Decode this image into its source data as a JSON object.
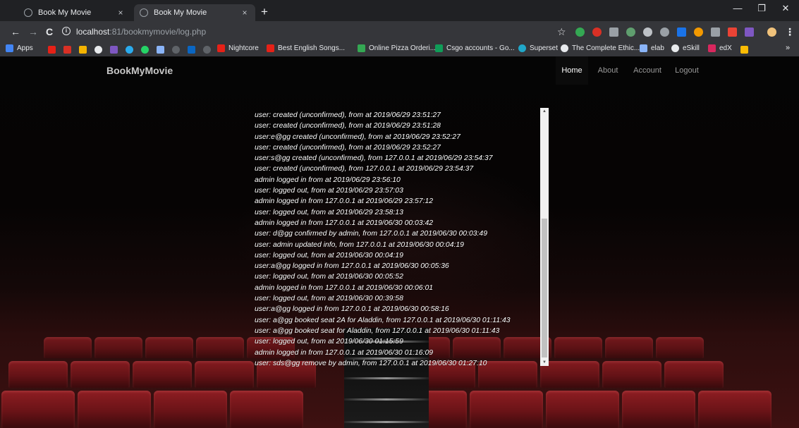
{
  "browser": {
    "tabs": [
      {
        "title": "Book My Movie",
        "active": false
      },
      {
        "title": "Book My Movie",
        "active": true
      }
    ],
    "close_glyph": "×",
    "new_tab_glyph": "+",
    "window_controls": {
      "minimize": "—",
      "maximize": "❐",
      "close": "✕"
    },
    "nav": {
      "back": "←",
      "forward": "→",
      "reload": "C"
    },
    "url": {
      "host": "localhost",
      "rest": ":81/bookmymovie/log.php"
    },
    "star_glyph": "☆",
    "menu_glyph": "⋮",
    "bookmarks": [
      {
        "label": "Apps",
        "color": "#4285f4"
      },
      {
        "label": "Nightcore",
        "color": "#e62117"
      },
      {
        "label": "Best English Songs...",
        "color": "#e62117"
      },
      {
        "label": "Online Pizza Orderi...",
        "color": "#34a853"
      },
      {
        "label": "Csgo accounts - Go...",
        "color": "#0f9d58"
      },
      {
        "label": "Superset",
        "color": "#20a7c9"
      },
      {
        "label": "The Complete Ethic...",
        "color": "#e8eaed"
      },
      {
        "label": "elab",
        "color": "#8ab4f8"
      },
      {
        "label": "eSkill",
        "color": "#e8eaed"
      },
      {
        "label": "edX",
        "color": "#d9275e"
      }
    ],
    "bookmarks_overflow": "»"
  },
  "page": {
    "brand": "BookMyMovie",
    "nav": [
      {
        "label": "Home",
        "active": true
      },
      {
        "label": "About",
        "active": false
      },
      {
        "label": "Account",
        "active": false
      },
      {
        "label": "Logout",
        "active": false
      }
    ],
    "log": [
      "user: created (unconfirmed), from at 2019/06/29 23:51:27",
      "user: created (unconfirmed), from at 2019/06/29 23:51:28",
      "user:e@gg created (unconfirmed), from at 2019/06/29 23:52:27",
      "user: created (unconfirmed), from at 2019/06/29 23:52:27",
      "user:s@gg created (unconfirmed), from 127.0.0.1 at 2019/06/29 23:54:37",
      "user: created (unconfirmed), from 127.0.0.1 at 2019/06/29 23:54:37",
      "admin logged in from at 2019/06/29 23:56:10",
      "user: logged out, from at 2019/06/29 23:57:03",
      "admin logged in from 127.0.0.1 at 2019/06/29 23:57:12",
      "user: logged out, from at 2019/06/29 23:58:13",
      "admin logged in from 127.0.0.1 at 2019/06/30 00:03:42",
      "user: d@gg confirmed by admin, from 127.0.0.1 at 2019/06/30 00:03:49",
      "user: admin updated info, from 127.0.0.1 at 2019/06/30 00:04:19",
      "user: logged out, from at 2019/06/30 00:04:19",
      "user:a@gg logged in from 127.0.0.1 at 2019/06/30 00:05:36",
      "user: logged out, from at 2019/06/30 00:05:52",
      "admin logged in from 127.0.0.1 at 2019/06/30 00:06:01",
      "user: logged out, from at 2019/06/30 00:39:58",
      "user:a@gg logged in from 127.0.0.1 at 2019/06/30 00:58:16",
      "user: a@gg booked seat 2A for Aladdin, from 127.0.0.1 at 2019/06/30 01:11:43",
      "user: a@gg booked seat for Aladdin, from 127.0.0.1 at 2019/06/30 01:11:43",
      "user: logged out, from at 2019/06/30 01:15:59",
      "admin logged in from 127.0.0.1 at 2019/06/30 01:16:09",
      "user: sds@gg remove by admin, from 127.0.0.1 at 2019/06/30 01:27:10"
    ],
    "scroll_up_glyph": "▲",
    "scroll_down_glyph": "▼"
  },
  "icons": {
    "tab_favicon": "globe-icon",
    "info": "info-icon",
    "star": "bookmark-star-icon",
    "profile": "profile-avatar-icon"
  },
  "colors": {
    "chrome_dark": "#202124",
    "chrome_toolbar": "#35363a",
    "seat_red": "#8e1d22",
    "page_bg": "#000000"
  }
}
